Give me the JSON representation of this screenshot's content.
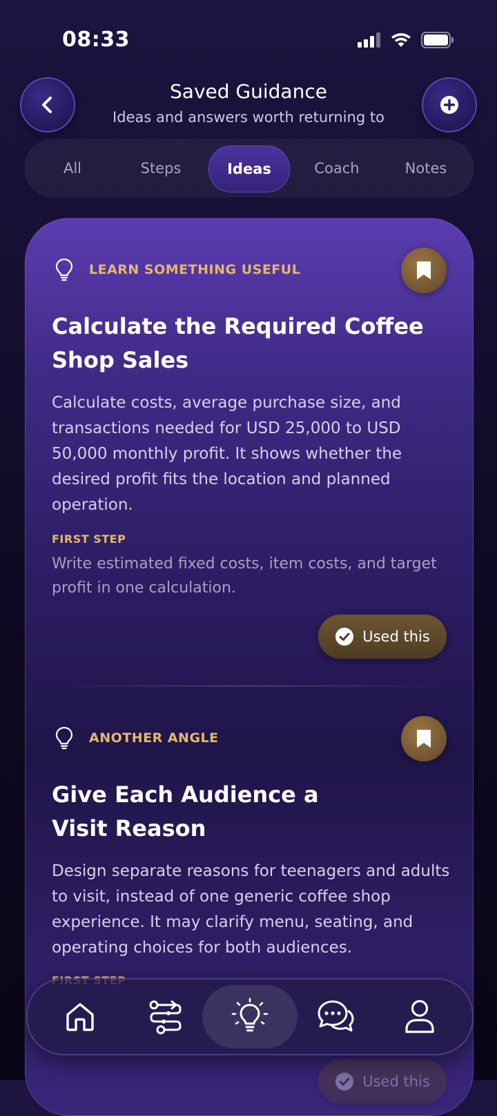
{
  "status_bar": {
    "time": "08:33",
    "icons": [
      "signal-icon",
      "wifi-icon",
      "battery-icon"
    ]
  },
  "header": {
    "title": "Saved Guidance",
    "subtitle": "Ideas and answers worth returning to",
    "back_icon": "chevron-left-icon",
    "add_icon": "plus-circle-icon"
  },
  "tabs": [
    {
      "label": "All",
      "active": false
    },
    {
      "label": "Steps",
      "active": false
    },
    {
      "label": "Ideas",
      "active": true
    },
    {
      "label": "Coach",
      "active": false
    },
    {
      "label": "Notes",
      "active": false
    }
  ],
  "cards": [
    {
      "eyebrow": "LEARN SOMETHING USEFUL",
      "title_lines": [
        "Calculate the Required Coffee",
        "Shop Sales"
      ],
      "body": "Calculate costs, average purchase size, and transactions needed for USD 25,000 to USD 50,000 monthly profit. It shows whether the desired profit fits the location and planned operation.",
      "step_label": "FIRST STEP",
      "step_text": "Write estimated fixed costs, item costs, and target profit in one calculation.",
      "action_label": "Used this"
    },
    {
      "eyebrow": "ANOTHER ANGLE",
      "title_lines": [
        "Give Each Audience a",
        "Visit Reason"
      ],
      "body": "Design separate reasons for teenagers and adults to visit, instead of one generic coffee shop experience. It may clarify menu, seating, and operating choices for both audiences.",
      "step_label": "FIRST STEP",
      "action_label": "Used this"
    }
  ],
  "nav": [
    {
      "icon": "home-icon",
      "active": false
    },
    {
      "icon": "path-steps-icon",
      "active": false
    },
    {
      "icon": "lightbulb-icon",
      "active": true
    },
    {
      "icon": "chat-icon",
      "active": false
    },
    {
      "icon": "profile-icon",
      "active": false
    }
  ],
  "colors": {
    "accent_gold": "#e7b868",
    "purple": "#4a339e",
    "background": "#150e30"
  }
}
